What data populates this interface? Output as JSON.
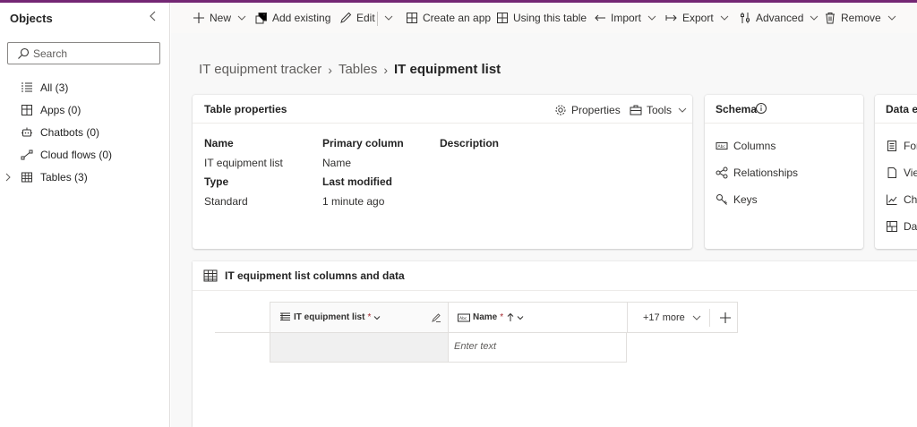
{
  "objects_pane": {
    "title": "Objects",
    "search_placeholder": "Search",
    "items": [
      {
        "label": "All (3)",
        "icon": "list-icon"
      },
      {
        "label": "Apps (0)",
        "icon": "apps-icon"
      },
      {
        "label": "Chatbots (0)",
        "icon": "chatbot-icon"
      },
      {
        "label": "Cloud flows (0)",
        "icon": "flow-icon"
      },
      {
        "label": "Tables (3)",
        "icon": "table-icon"
      }
    ]
  },
  "command_bar": {
    "new": "New",
    "add_existing": "Add existing",
    "edit": "Edit",
    "create_app": "Create an app",
    "using_table": "Using this table",
    "import": "Import",
    "export": "Export",
    "advanced": "Advanced",
    "remove": "Remove"
  },
  "breadcrumb": {
    "solution": "IT equipment tracker",
    "tables": "Tables",
    "current": "IT equipment list"
  },
  "table_properties": {
    "title": "Table properties",
    "properties_btn": "Properties",
    "tools_btn": "Tools",
    "name_label": "Name",
    "name_value": "IT equipment list",
    "primary_label": "Primary column",
    "primary_value": "Name",
    "description_label": "Description",
    "type_label": "Type",
    "type_value": "Standard",
    "modified_label": "Last modified",
    "modified_value": "1 minute ago"
  },
  "schema": {
    "title": "Schema",
    "items": [
      "Columns",
      "Relationships",
      "Keys"
    ]
  },
  "data_experiences": {
    "title": "Data e",
    "items": [
      "For",
      "Vie",
      "Cha",
      "Das"
    ]
  },
  "grid": {
    "title": "IT equipment list columns and data",
    "col1": "IT equipment list",
    "col2": "Name",
    "required_mark": "*",
    "more_cols": "+17 more",
    "cell_placeholder": "Enter text"
  },
  "colors": {
    "accent": "#742774",
    "text": "#242424",
    "muted": "#605e5c"
  }
}
